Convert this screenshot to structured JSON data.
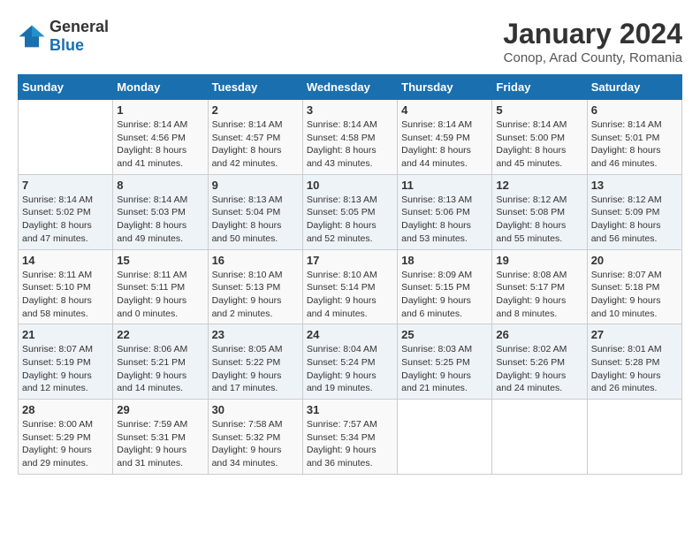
{
  "logo": {
    "general": "General",
    "blue": "Blue"
  },
  "title": "January 2024",
  "subtitle": "Conop, Arad County, Romania",
  "days_header": [
    "Sunday",
    "Monday",
    "Tuesday",
    "Wednesday",
    "Thursday",
    "Friday",
    "Saturday"
  ],
  "weeks": [
    [
      {
        "day": "",
        "info": ""
      },
      {
        "day": "1",
        "info": "Sunrise: 8:14 AM\nSunset: 4:56 PM\nDaylight: 8 hours\nand 41 minutes."
      },
      {
        "day": "2",
        "info": "Sunrise: 8:14 AM\nSunset: 4:57 PM\nDaylight: 8 hours\nand 42 minutes."
      },
      {
        "day": "3",
        "info": "Sunrise: 8:14 AM\nSunset: 4:58 PM\nDaylight: 8 hours\nand 43 minutes."
      },
      {
        "day": "4",
        "info": "Sunrise: 8:14 AM\nSunset: 4:59 PM\nDaylight: 8 hours\nand 44 minutes."
      },
      {
        "day": "5",
        "info": "Sunrise: 8:14 AM\nSunset: 5:00 PM\nDaylight: 8 hours\nand 45 minutes."
      },
      {
        "day": "6",
        "info": "Sunrise: 8:14 AM\nSunset: 5:01 PM\nDaylight: 8 hours\nand 46 minutes."
      }
    ],
    [
      {
        "day": "7",
        "info": "Sunrise: 8:14 AM\nSunset: 5:02 PM\nDaylight: 8 hours\nand 47 minutes."
      },
      {
        "day": "8",
        "info": "Sunrise: 8:14 AM\nSunset: 5:03 PM\nDaylight: 8 hours\nand 49 minutes."
      },
      {
        "day": "9",
        "info": "Sunrise: 8:13 AM\nSunset: 5:04 PM\nDaylight: 8 hours\nand 50 minutes."
      },
      {
        "day": "10",
        "info": "Sunrise: 8:13 AM\nSunset: 5:05 PM\nDaylight: 8 hours\nand 52 minutes."
      },
      {
        "day": "11",
        "info": "Sunrise: 8:13 AM\nSunset: 5:06 PM\nDaylight: 8 hours\nand 53 minutes."
      },
      {
        "day": "12",
        "info": "Sunrise: 8:12 AM\nSunset: 5:08 PM\nDaylight: 8 hours\nand 55 minutes."
      },
      {
        "day": "13",
        "info": "Sunrise: 8:12 AM\nSunset: 5:09 PM\nDaylight: 8 hours\nand 56 minutes."
      }
    ],
    [
      {
        "day": "14",
        "info": "Sunrise: 8:11 AM\nSunset: 5:10 PM\nDaylight: 8 hours\nand 58 minutes."
      },
      {
        "day": "15",
        "info": "Sunrise: 8:11 AM\nSunset: 5:11 PM\nDaylight: 9 hours\nand 0 minutes."
      },
      {
        "day": "16",
        "info": "Sunrise: 8:10 AM\nSunset: 5:13 PM\nDaylight: 9 hours\nand 2 minutes."
      },
      {
        "day": "17",
        "info": "Sunrise: 8:10 AM\nSunset: 5:14 PM\nDaylight: 9 hours\nand 4 minutes."
      },
      {
        "day": "18",
        "info": "Sunrise: 8:09 AM\nSunset: 5:15 PM\nDaylight: 9 hours\nand 6 minutes."
      },
      {
        "day": "19",
        "info": "Sunrise: 8:08 AM\nSunset: 5:17 PM\nDaylight: 9 hours\nand 8 minutes."
      },
      {
        "day": "20",
        "info": "Sunrise: 8:07 AM\nSunset: 5:18 PM\nDaylight: 9 hours\nand 10 minutes."
      }
    ],
    [
      {
        "day": "21",
        "info": "Sunrise: 8:07 AM\nSunset: 5:19 PM\nDaylight: 9 hours\nand 12 minutes."
      },
      {
        "day": "22",
        "info": "Sunrise: 8:06 AM\nSunset: 5:21 PM\nDaylight: 9 hours\nand 14 minutes."
      },
      {
        "day": "23",
        "info": "Sunrise: 8:05 AM\nSunset: 5:22 PM\nDaylight: 9 hours\nand 17 minutes."
      },
      {
        "day": "24",
        "info": "Sunrise: 8:04 AM\nSunset: 5:24 PM\nDaylight: 9 hours\nand 19 minutes."
      },
      {
        "day": "25",
        "info": "Sunrise: 8:03 AM\nSunset: 5:25 PM\nDaylight: 9 hours\nand 21 minutes."
      },
      {
        "day": "26",
        "info": "Sunrise: 8:02 AM\nSunset: 5:26 PM\nDaylight: 9 hours\nand 24 minutes."
      },
      {
        "day": "27",
        "info": "Sunrise: 8:01 AM\nSunset: 5:28 PM\nDaylight: 9 hours\nand 26 minutes."
      }
    ],
    [
      {
        "day": "28",
        "info": "Sunrise: 8:00 AM\nSunset: 5:29 PM\nDaylight: 9 hours\nand 29 minutes."
      },
      {
        "day": "29",
        "info": "Sunrise: 7:59 AM\nSunset: 5:31 PM\nDaylight: 9 hours\nand 31 minutes."
      },
      {
        "day": "30",
        "info": "Sunrise: 7:58 AM\nSunset: 5:32 PM\nDaylight: 9 hours\nand 34 minutes."
      },
      {
        "day": "31",
        "info": "Sunrise: 7:57 AM\nSunset: 5:34 PM\nDaylight: 9 hours\nand 36 minutes."
      },
      {
        "day": "",
        "info": ""
      },
      {
        "day": "",
        "info": ""
      },
      {
        "day": "",
        "info": ""
      }
    ]
  ]
}
